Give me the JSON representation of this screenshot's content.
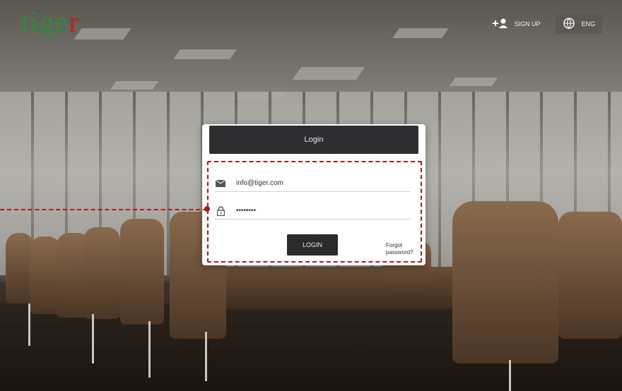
{
  "logo": {
    "part1": "tige",
    "part2": "r"
  },
  "header": {
    "signup": {
      "icon": "add-user-icon",
      "label": "SIGN UP"
    },
    "language": {
      "icon": "globe-icon",
      "label": "ENG"
    }
  },
  "login": {
    "title": "Login",
    "email": {
      "icon": "envelope-icon",
      "value": "info@tiger.com"
    },
    "password": {
      "icon": "lock-icon",
      "value": "••••••••"
    },
    "button_label": "LOGIN",
    "forgot_label": "Forgot password?"
  },
  "colors": {
    "logo_green": "#2f8a3e",
    "logo_red": "#c0201b",
    "highlight": "#b01c1c",
    "dark": "#2e2e30"
  }
}
